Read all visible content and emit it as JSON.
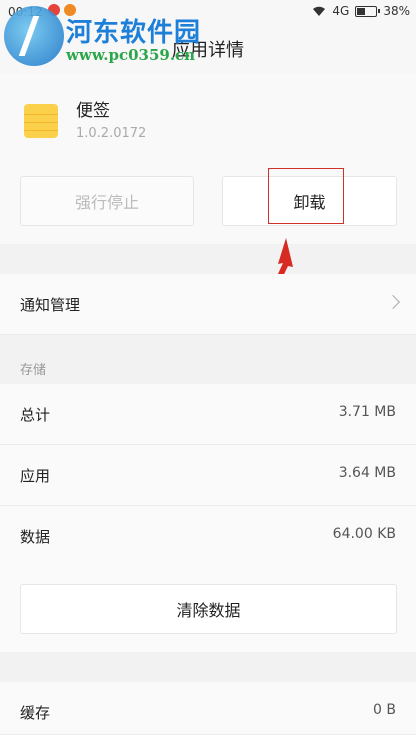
{
  "status": {
    "time": "00:12",
    "network": "4G",
    "battery": "38%",
    "battery_level": 0.38
  },
  "watermark": {
    "name": "河东软件园",
    "url": "www.pc0359.cn"
  },
  "header": {
    "title": "应用详情"
  },
  "app": {
    "name": "便签",
    "version": "1.0.2.0172",
    "icon": "notes-icon"
  },
  "actions": {
    "force_stop": "强行停止",
    "uninstall": "卸载"
  },
  "notifications": {
    "label": "通知管理"
  },
  "storage": {
    "section_title": "存储",
    "rows": [
      {
        "label": "总计",
        "value": "3.71 MB"
      },
      {
        "label": "应用",
        "value": "3.64 MB"
      },
      {
        "label": "数据",
        "value": "64.00 KB"
      }
    ],
    "clear_button": "清除数据"
  },
  "cache": {
    "label": "缓存",
    "value": "0 B"
  },
  "colors": {
    "highlight": "#d0302a",
    "app_icon": "#fbd04a"
  }
}
